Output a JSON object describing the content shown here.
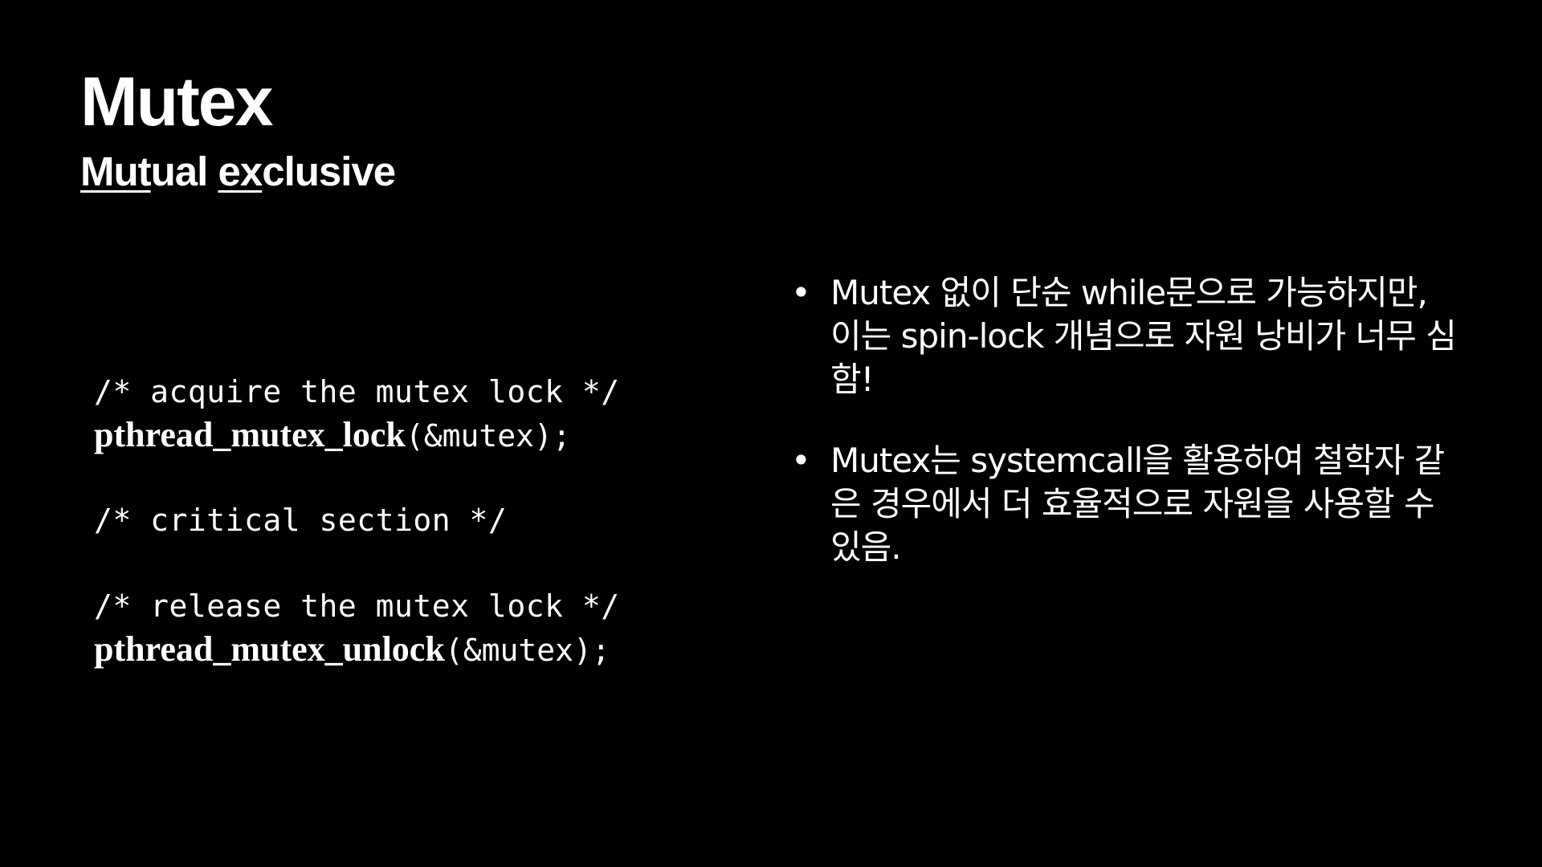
{
  "title": "Mutex",
  "subtitle": {
    "part1_underlined": "Mut",
    "part1_rest": "ual",
    "space": " ",
    "part2_underlined": "ex",
    "part2_rest": "clusive"
  },
  "code": {
    "acquire_comment": "/* acquire the mutex lock */",
    "lock_fn": "pthread_mutex_lock",
    "lock_arg": "(&mutex);",
    "critical_comment": "/* critical section */",
    "release_comment": "/* release the mutex lock */",
    "unlock_fn": "pthread_mutex_unlock",
    "unlock_arg": "(&mutex);"
  },
  "bullets": [
    {
      "marker": "•",
      "text": "Mutex 없이 단순 while문으로 가능하지만, 이는 spin-lock 개념으로 자원 낭비가 너무 심함!"
    },
    {
      "marker": "•",
      "text": "Mutex는 systemcall을 활용하여 철학자 같은 경우에서 더 효율적으로 자원을 사용할 수 있음."
    }
  ]
}
